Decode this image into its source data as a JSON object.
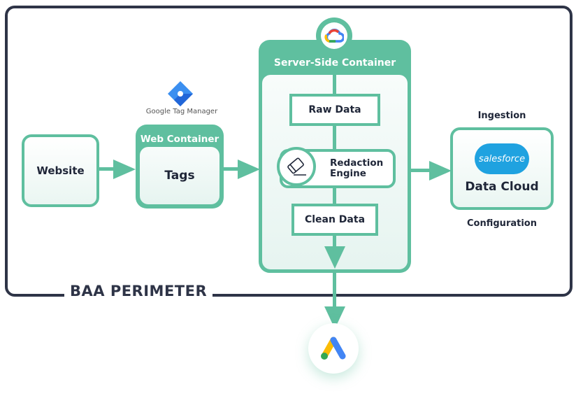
{
  "perimeter_label": "BAA PERIMETER",
  "website": "Website",
  "gtm": {
    "logo_text": "Google Tag Manager",
    "container_title": "Web Container",
    "content": "Tags"
  },
  "server": {
    "title": "Server-Side Container",
    "raw": "Raw Data",
    "redaction_line1": "Redaction",
    "redaction_line2": "Engine",
    "clean": "Clean Data",
    "icon": "google-cloud-icon"
  },
  "destination": {
    "top_label": "Ingestion",
    "logo_text": "salesforce",
    "name": "Data Cloud",
    "bottom_label": "Configuration"
  },
  "bottom_icon": "google-ads-icon",
  "colors": {
    "accent": "#5fbf9f",
    "dark": "#2e3447"
  }
}
